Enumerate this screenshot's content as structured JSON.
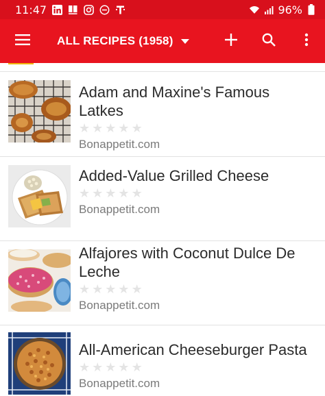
{
  "status_bar": {
    "time": "11:47",
    "battery_percent": "96%",
    "left_icons": [
      "linkedin-icon",
      "news-icon",
      "instagram-icon",
      "dnd-icon",
      "tmobile-icon"
    ],
    "right_icons": [
      "wifi-icon",
      "signal-icon",
      "battery-icon"
    ]
  },
  "app_bar": {
    "title": "ALL RECIPES (1958)",
    "background": "#e8141f",
    "actions": [
      "add-icon",
      "search-icon",
      "more-vert-icon"
    ]
  },
  "recipes": [
    {
      "title": "Adam and Maxine's Famous Latkes",
      "rating": 0,
      "max_rating": 5,
      "source": "Bonappetit.com",
      "image": "latkes-photo"
    },
    {
      "title": "Added-Value Grilled Cheese",
      "rating": 0,
      "max_rating": 5,
      "source": "Bonappetit.com",
      "image": "grilled-cheese-photo"
    },
    {
      "title": "Alfajores with Coconut Dulce De Leche",
      "rating": 0,
      "max_rating": 5,
      "source": "Bonappetit.com",
      "image": "alfajores-photo"
    },
    {
      "title": "All-American Cheeseburger Pasta",
      "rating": 0,
      "max_rating": 5,
      "source": "Bonappetit.com",
      "image": "pasta-photo"
    }
  ]
}
